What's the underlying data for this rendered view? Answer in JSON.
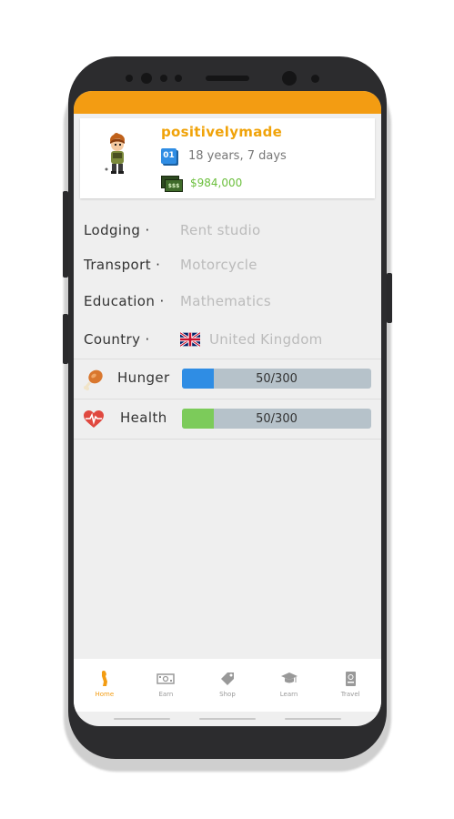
{
  "profile": {
    "username": "positivelymade",
    "calendar_badge": "01",
    "age": "18 years, 7 days",
    "cash_icon_label": "$$$",
    "money": "$984,000"
  },
  "info": [
    {
      "label": "Lodging ·",
      "value": "Rent studio"
    },
    {
      "label": "Transport ·",
      "value": "Motorcycle"
    },
    {
      "label": "Education ·",
      "value": "Mathematics"
    },
    {
      "label": "Country ·",
      "value": "United Kingdom",
      "flag_icon": "uk-flag-icon"
    }
  ],
  "stats": [
    {
      "label": "Hunger",
      "value_text": "50/300",
      "fraction": 0.1667,
      "color": "#2f8de4",
      "icon": "drumstick-icon"
    },
    {
      "label": "Health",
      "value_text": "50/300",
      "fraction": 0.1667,
      "color": "#7ccb5a",
      "icon": "heart-pulse-icon"
    }
  ],
  "nav": [
    {
      "label": "Home",
      "icon": "home-person-icon",
      "active": true
    },
    {
      "label": "Earn",
      "icon": "cash-icon",
      "active": false
    },
    {
      "label": "Shop",
      "icon": "tag-icon",
      "active": false
    },
    {
      "label": "Learn",
      "icon": "graduation-cap-icon",
      "active": false
    },
    {
      "label": "Travel",
      "icon": "passport-icon",
      "active": false
    }
  ],
  "colors": {
    "accent": "#f39c12",
    "username": "#f0a30a",
    "money": "#6bbf3c"
  }
}
